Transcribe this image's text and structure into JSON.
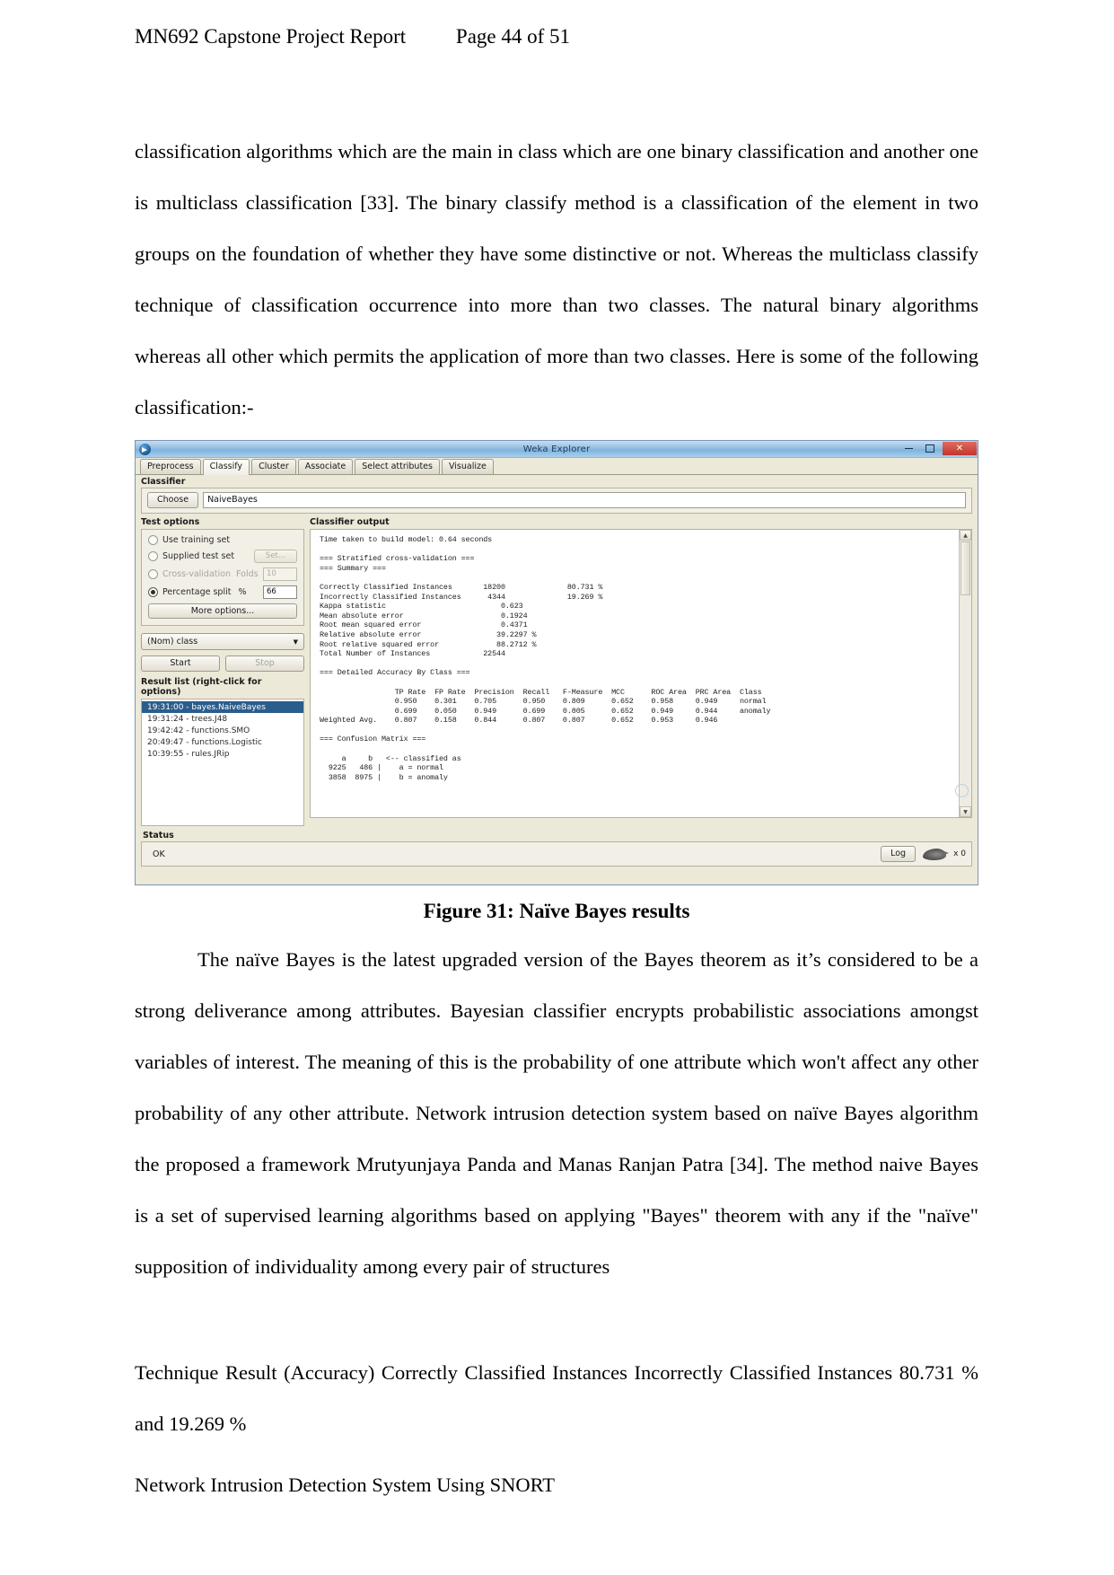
{
  "header": {
    "title": "MN692 Capstone Project Report",
    "page": "Page 44 of 51"
  },
  "paragraphs": {
    "p1": "classification algorithms which are the main in class which are one binary classification and another one is multiclass classification [33]. The binary classify method is a classification of the element in two groups on the foundation of whether they have some distinctive or not. Whereas the multiclass classify technique of classification occurrence into more than two classes. The natural binary algorithms whereas all other which permits the application of more than two classes. Here is some of the following classification:-",
    "p2": "The naïve Bayes is the latest upgraded version of the Bayes theorem as it’s considered to be a strong deliverance among attributes. Bayesian classifier encrypts probabilistic associations amongst variables of interest. The meaning of this is the probability of one attribute which won't affect any other probability of any other attribute. Network intrusion detection system based on naïve Bayes algorithm the proposed a framework Mrutyunjaya Panda and Manas Ranjan Patra [34]. The method naive Bayes is a set of supervised learning algorithms based on applying \"Bayes\" theorem with any if the \"naïve\" supposition of individuality among every pair of structures",
    "p3": "Technique Result (Accuracy) Correctly Classified Instances Incorrectly Classified Instances 80.731 % and 19.269 %",
    "p4": "Network Intrusion Detection System Using SNORT"
  },
  "figure": {
    "caption": "Figure 31: Naïve Bayes results"
  },
  "weka": {
    "window_title": "Weka Explorer",
    "window_buttons": {
      "minimize": "–",
      "maximize": "❐",
      "close": "✕"
    },
    "tabs": [
      {
        "label": "Preprocess",
        "active": false
      },
      {
        "label": "Classify",
        "active": true
      },
      {
        "label": "Cluster",
        "active": false
      },
      {
        "label": "Associate",
        "active": false
      },
      {
        "label": "Select attributes",
        "active": false
      },
      {
        "label": "Visualize",
        "active": false
      }
    ],
    "classifier": {
      "panel_label": "Classifier",
      "choose_button": "Choose",
      "value": "NaiveBayes"
    },
    "test_options": {
      "title": "Test options",
      "items": [
        {
          "label": "Use training set",
          "selected": false
        },
        {
          "label": "Supplied test set",
          "selected": false,
          "button": "Set..."
        },
        {
          "label": "Cross-validation",
          "selected": false,
          "sub_label": "Folds",
          "sub_value": "10"
        },
        {
          "label": "Percentage split",
          "selected": true,
          "sub_label": "%",
          "sub_value": "66"
        }
      ],
      "more_options": "More options..."
    },
    "class_combo": "(Nom) class",
    "start_button": "Start",
    "stop_button": "Stop",
    "result_list_label": "Result list (right-click for options)",
    "result_list": [
      {
        "label": "19:31:00 - bayes.NaiveBayes",
        "selected": true
      },
      {
        "label": "19:31:24 - trees.J48",
        "selected": false
      },
      {
        "label": "19:42:42 - functions.SMO",
        "selected": false
      },
      {
        "label": "20:49:47 - functions.Logistic",
        "selected": false
      },
      {
        "label": "10:39:55 - rules.JRip",
        "selected": false
      }
    ],
    "output_label": "Classifier output",
    "output_text": "Time taken to build model: 0.64 seconds\n\n=== Stratified cross-validation ===\n=== Summary ===\n\nCorrectly Classified Instances       18200              80.731 %\nIncorrectly Classified Instances      4344              19.269 %\nKappa statistic                          0.623\nMean absolute error                      0.1924\nRoot mean squared error                  0.4371\nRelative absolute error                 39.2297 %\nRoot relative squared error             88.2712 %\nTotal Number of Instances            22544\n\n=== Detailed Accuracy By Class ===\n\n                 TP Rate  FP Rate  Precision  Recall   F-Measure  MCC      ROC Area  PRC Area  Class\n                 0.950    0.301    0.705      0.950    0.809      0.652    0.958     0.949     normal\n                 0.699    0.050    0.949      0.699    0.805      0.652    0.949     0.944     anomaly\nWeighted Avg.    0.807    0.158    0.844      0.807    0.807      0.652    0.953     0.946\n\n=== Confusion Matrix ===\n\n     a     b   <-- classified as\n  9225   486 |    a = normal\n  3858  8975 |    b = anomaly",
    "status": {
      "label": "Status",
      "text": "OK",
      "log_button": "Log",
      "bird_count": "x 0"
    }
  },
  "chart_data": {
    "type": "table",
    "title": "Naïve Bayes results (Weka cross-validation summary)",
    "summary": {
      "time_taken_seconds": 0.64,
      "correctly_classified_instances": 18200,
      "correctly_classified_percent": 80.731,
      "incorrectly_classified_instances": 4344,
      "incorrectly_classified_percent": 19.269,
      "kappa_statistic": 0.623,
      "mean_absolute_error": 0.1924,
      "root_mean_squared_error": 0.4371,
      "relative_absolute_error_percent": 39.2297,
      "root_relative_squared_error_percent": 88.2712,
      "total_number_of_instances": 22544
    },
    "columns": [
      "TP Rate",
      "FP Rate",
      "Precision",
      "Recall",
      "F-Measure",
      "MCC",
      "ROC Area",
      "PRC Area",
      "Class"
    ],
    "rows": [
      [
        "0.950",
        "0.301",
        "0.705",
        "0.950",
        "0.809",
        "0.652",
        "0.958",
        "0.949",
        "normal"
      ],
      [
        "0.699",
        "0.050",
        "0.949",
        "0.699",
        "0.805",
        "0.652",
        "0.949",
        "0.944",
        "anomaly"
      ],
      [
        "0.807",
        "0.158",
        "0.844",
        "0.807",
        "0.807",
        "0.652",
        "0.953",
        "0.946",
        "Weighted Avg."
      ]
    ],
    "confusion_matrix": {
      "labels": [
        "a = normal",
        "b = anomaly"
      ],
      "values": [
        [
          9225,
          486
        ],
        [
          3858,
          8975
        ]
      ]
    }
  }
}
